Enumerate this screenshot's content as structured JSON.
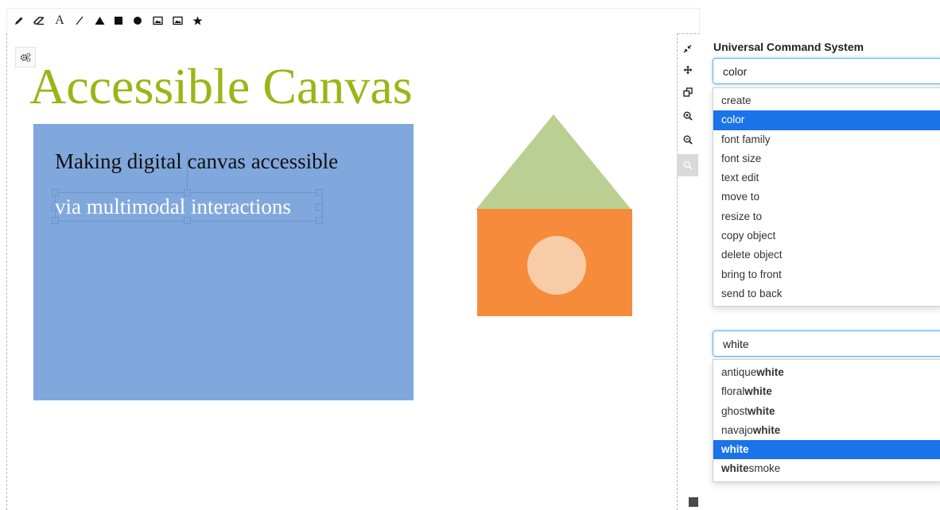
{
  "toolbar": {
    "tools": [
      {
        "icon": "pencil-icon"
      },
      {
        "icon": "eraser-icon"
      },
      {
        "icon": "text-tool-icon",
        "label": "A"
      },
      {
        "icon": "line-icon"
      },
      {
        "icon": "triangle-icon"
      },
      {
        "icon": "square-icon"
      },
      {
        "icon": "circle-icon"
      },
      {
        "icon": "image-icon"
      },
      {
        "icon": "image-icon"
      },
      {
        "icon": "star-icon"
      }
    ]
  },
  "canvas": {
    "title": "Accessible Canvas",
    "text_box": {
      "line1": "Making digital canvas accessible",
      "line2": "via multimodal interactions"
    },
    "colors": {
      "title": "#9ab516",
      "text_rect": "#80a8dd",
      "house_roof": "#bccf92",
      "house_body": "#f58b3b",
      "house_window": "#f9cca8"
    }
  },
  "side_toolbar": {
    "tools": [
      {
        "icon": "collapse-icon"
      },
      {
        "icon": "move-icon"
      },
      {
        "icon": "copy-icon"
      },
      {
        "icon": "zoom-in-icon"
      },
      {
        "icon": "zoom-out-icon"
      },
      {
        "icon": "search-icon",
        "active": true
      }
    ]
  },
  "command_panel": {
    "title": "Universal Command System",
    "command_input": {
      "value": "color"
    },
    "command_options": [
      {
        "label": "create"
      },
      {
        "label": "color",
        "selected": true
      },
      {
        "label": "font family"
      },
      {
        "label": "font size"
      },
      {
        "label": "text edit"
      },
      {
        "label": "move to"
      },
      {
        "label": "resize to"
      },
      {
        "label": "copy object"
      },
      {
        "label": "delete object"
      },
      {
        "label": "bring to front"
      },
      {
        "label": "send to back"
      }
    ],
    "value_input": {
      "value": "white"
    },
    "value_options": [
      {
        "pre": "antique",
        "match": "white",
        "post": ""
      },
      {
        "pre": "floral",
        "match": "white",
        "post": ""
      },
      {
        "pre": "ghost",
        "match": "white",
        "post": ""
      },
      {
        "pre": "navajo",
        "match": "white",
        "post": ""
      },
      {
        "pre": "",
        "match": "white",
        "post": "",
        "selected": true
      },
      {
        "pre": "",
        "match": "white",
        "post": "smoke"
      }
    ],
    "accent_color": "#1a73e8"
  }
}
